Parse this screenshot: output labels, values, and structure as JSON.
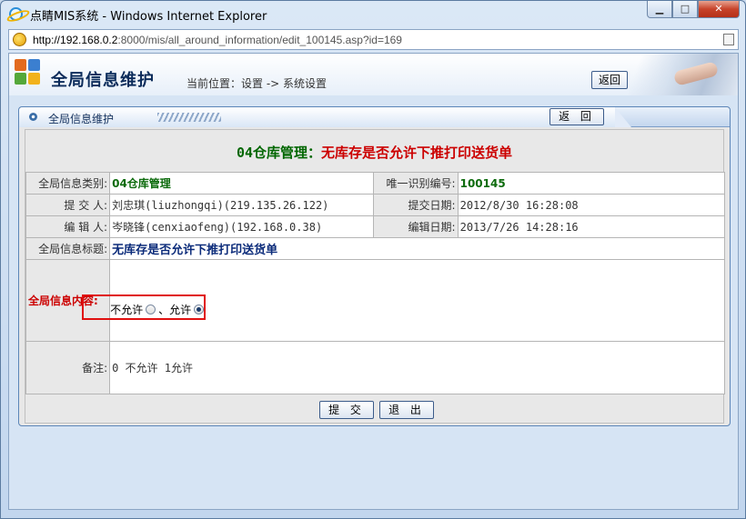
{
  "window": {
    "title": "点睛MIS系统 - Windows Internet Explorer",
    "url_host": "http://192.168.0.2",
    "url_rest": ":8000/mis/all_around_information/edit_100145.asp?id=169",
    "min_glyph": "▁",
    "max_glyph": "□",
    "close_glyph": "✕"
  },
  "header": {
    "title": "全局信息维护",
    "breadcrumb": "当前位置：设置 -> 系统设置",
    "back_label": "返回"
  },
  "panel": {
    "tab_title": "全局信息维护",
    "back_label": "返 回",
    "heading_code": "04仓库管理：",
    "heading_text": "无库存是否允许下推打印送货单"
  },
  "form": {
    "category_label": "全局信息类别:",
    "category_value": "04仓库管理",
    "uid_label": "唯一识别编号:",
    "uid_value": "100145",
    "submitter_label": "提 交 人:",
    "submitter_value": "刘忠琪(liuzhongqi)(219.135.26.122)",
    "submit_date_label": "提交日期:",
    "submit_date_value": "2012/8/30 16:28:08",
    "editor_label": "编 辑 人:",
    "editor_value": "岑晓锋(cenxiaofeng)(192.168.0.38)",
    "edit_date_label": "编辑日期:",
    "edit_date_value": "2013/7/26 14:28:16",
    "info_title_label": "全局信息标题:",
    "info_title_value": "无库存是否允许下推打印送货单",
    "content_label": "全局信息内容:",
    "option_no": "不允许",
    "option_sep": "、",
    "option_yes": "允许",
    "selected": "允许",
    "remark_label": "备注:",
    "remark_value": "0 不允许 1允许"
  },
  "buttons": {
    "submit": "提 交",
    "exit": "退 出"
  },
  "colors": {
    "heading_red": "#cc0000",
    "category_green": "#0c6b0c",
    "highlight_red": "#e01010"
  }
}
